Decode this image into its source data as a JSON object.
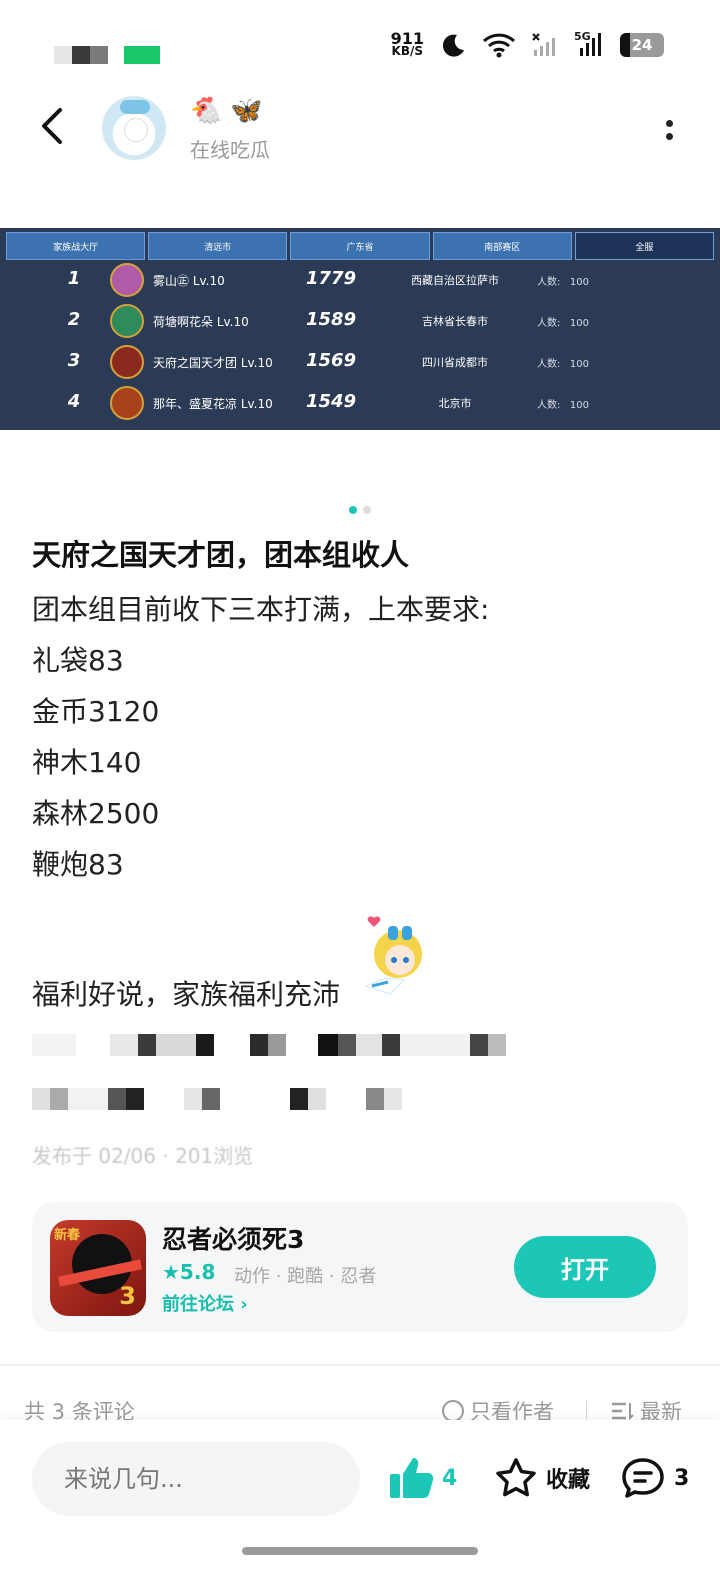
{
  "status_bar": {
    "net_speed_value": "911",
    "net_speed_unit": "KB/S",
    "signal_label": "5G",
    "battery": "24"
  },
  "header": {
    "username": "在线吃瓜",
    "badges": [
      "🐔",
      "🦋"
    ]
  },
  "banner": {
    "tabs": [
      "家族战大厅",
      "清远市",
      "广东省",
      "南部赛区",
      "全服"
    ],
    "rows": [
      {
        "rank": "1",
        "name": "雾山㊣  Lv.10",
        "score": "1779",
        "location": "西藏自治区拉萨市",
        "count_label": "人数:",
        "count": "100"
      },
      {
        "rank": "2",
        "name": "荷塘啊花朵  Lv.10",
        "score": "1589",
        "location": "吉林省长春市",
        "count_label": "人数:",
        "count": "100"
      },
      {
        "rank": "3",
        "name": "天府之国天才团  Lv.10",
        "score": "1569",
        "location": "四川省成都市",
        "count_label": "人数:",
        "count": "100"
      },
      {
        "rank": "4",
        "name": "那年、盛夏花凉  Lv.10",
        "score": "1549",
        "location": "北京市",
        "count_label": "人数:",
        "count": "100"
      }
    ]
  },
  "post": {
    "title": "天府之国天才团，团本组收人",
    "lines": [
      "团本组目前收下三本打满，上本要求:",
      "礼袋83",
      "金币3120",
      "神木140",
      "森林2500",
      "鞭炮83"
    ],
    "extra": "福利好说，家族福利充沛",
    "meta": "发布于 02/06 · 201浏览"
  },
  "app_card": {
    "name": "忍者必须死3",
    "rating": "★5.8",
    "genres": "动作 · 跑酷 · 忍者",
    "forum_link": "前往论坛 ›",
    "open_label": "打开",
    "icon_tag": "新春",
    "icon_number": "3"
  },
  "comments": {
    "count_text": "共 3 条评论",
    "only_author": "只看作者",
    "latest": "最新"
  },
  "bottom_bar": {
    "input_placeholder": "来说几句...",
    "like_count": "4",
    "favorite_label": "收藏",
    "comment_count": "3"
  },
  "colors": {
    "accent": "#1cc7b7",
    "banner_bg": "#2b3a55",
    "tab_bg": "#3d72b0"
  }
}
